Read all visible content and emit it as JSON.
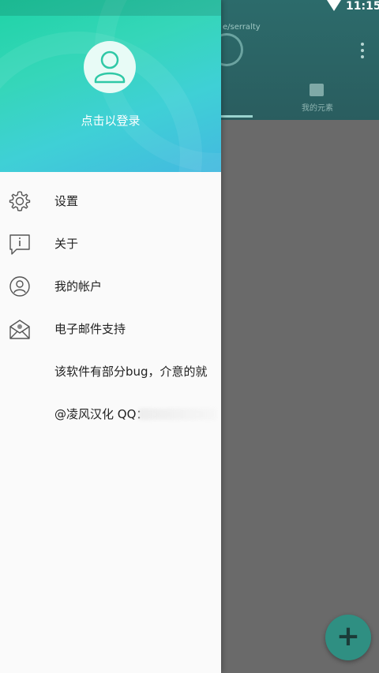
{
  "status_bar": {
    "time": "11:15",
    "wifi_icon": "wifi-icon"
  },
  "app": {
    "title_fragment": "e/serralty",
    "tab_label": "我的元素",
    "fab_icon": "plus-icon",
    "fab_symbol": "+"
  },
  "drawer": {
    "login_text": "点击以登录",
    "items": [
      {
        "label": "设置",
        "icon": "gear-icon"
      },
      {
        "label": "关于",
        "icon": "info-icon"
      },
      {
        "label": "我的帐户",
        "icon": "account-icon"
      },
      {
        "label": "电子邮件支持",
        "icon": "email-icon"
      },
      {
        "label": "该软件有部分bug，介意的就"
      },
      {
        "label": "@凌风汉化 QQ："
      }
    ]
  },
  "colors": {
    "header_gradient_start": "#1fd3a6",
    "header_gradient_end": "#43b9e0",
    "scrim": "#6a6a6a",
    "fab": "#2f8f82"
  }
}
